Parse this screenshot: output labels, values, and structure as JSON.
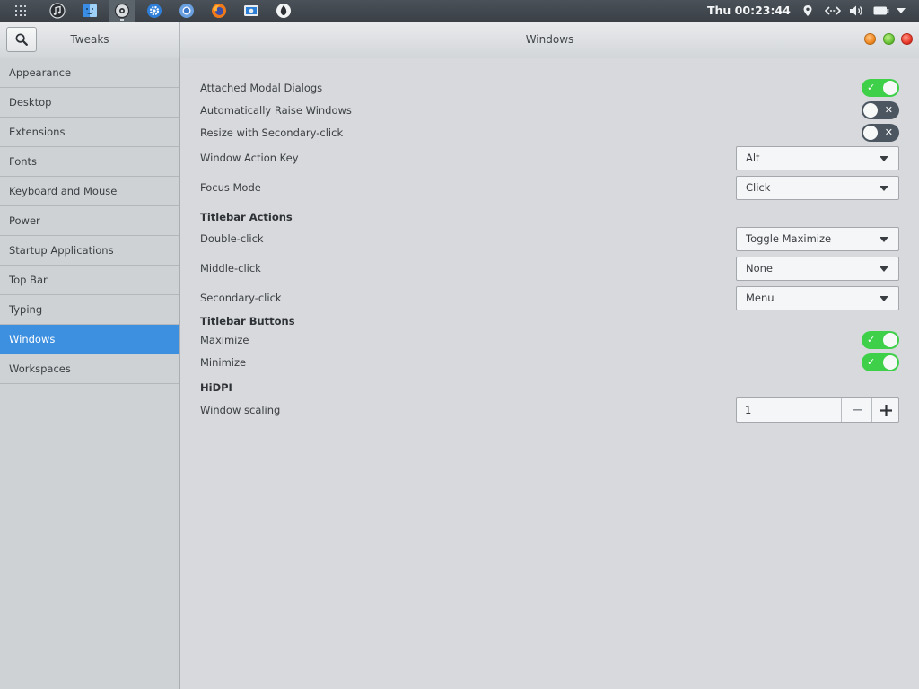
{
  "topbar": {
    "clock": "Thu 00:23:44",
    "apps": [
      "apps-grid-icon",
      "music-icon",
      "finder-icon",
      "settings-tweaks-icon",
      "gear-icon",
      "chrome-icon",
      "firefox-icon",
      "screenshot-icon",
      "inkscape-icon"
    ],
    "tray": [
      "location-icon",
      "network-icon",
      "volume-icon",
      "battery-icon",
      "chevron-down-icon"
    ]
  },
  "header": {
    "app_title": "Tweaks",
    "page_title": "Windows"
  },
  "sidebar": {
    "items": [
      {
        "label": "Appearance"
      },
      {
        "label": "Desktop"
      },
      {
        "label": "Extensions"
      },
      {
        "label": "Fonts"
      },
      {
        "label": "Keyboard and Mouse"
      },
      {
        "label": "Power"
      },
      {
        "label": "Startup Applications"
      },
      {
        "label": "Top Bar"
      },
      {
        "label": "Typing"
      },
      {
        "label": "Windows"
      },
      {
        "label": "Workspaces"
      }
    ],
    "selected": "Windows"
  },
  "main": {
    "attached_modal": {
      "label": "Attached Modal Dialogs",
      "state": "on"
    },
    "auto_raise": {
      "label": "Automatically Raise Windows",
      "state": "off"
    },
    "resize_secondary": {
      "label": "Resize with Secondary-click",
      "state": "off"
    },
    "action_key": {
      "label": "Window Action Key",
      "value": "Alt"
    },
    "focus_mode": {
      "label": "Focus Mode",
      "value": "Click"
    },
    "titlebar_actions": {
      "title": "Titlebar Actions",
      "double_click": {
        "label": "Double-click",
        "value": "Toggle Maximize"
      },
      "middle_click": {
        "label": "Middle-click",
        "value": "None"
      },
      "secondary_click": {
        "label": "Secondary-click",
        "value": "Menu"
      }
    },
    "titlebar_buttons": {
      "title": "Titlebar Buttons",
      "maximize": {
        "label": "Maximize",
        "state": "on"
      },
      "minimize": {
        "label": "Minimize",
        "state": "on"
      }
    },
    "hidpi": {
      "title": "HiDPI",
      "scaling": {
        "label": "Window scaling",
        "value": "1"
      }
    }
  },
  "colors": {
    "accent": "#3d8fe0",
    "switch_on": "#3fd04a",
    "switch_off": "#4b5660"
  }
}
